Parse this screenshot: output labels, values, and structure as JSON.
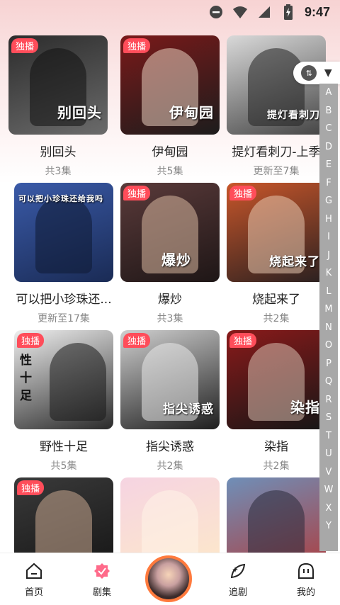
{
  "status_bar": {
    "time": "9:47"
  },
  "sort_control": {
    "icon": "sort-az-icon",
    "chevron": "chevron-down-icon"
  },
  "alphabet": [
    "A",
    "B",
    "C",
    "D",
    "E",
    "F",
    "G",
    "H",
    "I",
    "J",
    "K",
    "L",
    "M",
    "N",
    "O",
    "P",
    "Q",
    "R",
    "S",
    "T",
    "U",
    "V",
    "W",
    "X",
    "Y"
  ],
  "grid": {
    "items": [
      {
        "title": "别回头",
        "sub": "共3集",
        "badge": "独播",
        "cover_text": "别回头",
        "cover_colors": [
          "#2c2c2c",
          "#6b6b6b"
        ]
      },
      {
        "title": "伊甸园",
        "sub": "共5集",
        "badge": "独播",
        "cover_text": "伊甸园",
        "cover_colors": [
          "#7a1a1a",
          "#1c1c1c"
        ]
      },
      {
        "title": "提灯看刺刀-上季",
        "sub": "更新至7集",
        "badge": "",
        "cover_text": "提灯看刺刀",
        "cover_colors": [
          "#d9d9d9",
          "#444444"
        ]
      },
      {
        "title": "可以把小珍珠还...",
        "sub": "更新至17集",
        "badge": "",
        "cover_text": "可以把小珍珠还给我吗",
        "cover_colors": [
          "#3a5aa8",
          "#1a2b55"
        ]
      },
      {
        "title": "爆炒",
        "sub": "共3集",
        "badge": "独播",
        "cover_text": "爆炒",
        "cover_colors": [
          "#5a3a3a",
          "#1e1616"
        ]
      },
      {
        "title": "烧起来了",
        "sub": "共2集",
        "badge": "独播",
        "cover_text": "烧起来了",
        "cover_colors": [
          "#c8562a",
          "#2a2020"
        ]
      },
      {
        "title": "野性十足",
        "sub": "共5集",
        "badge": "独播",
        "cover_text": "性十足",
        "cover_colors": [
          "#efefef",
          "#2a2a2a"
        ]
      },
      {
        "title": "指尖诱惑",
        "sub": "共2集",
        "badge": "独播",
        "cover_text": "指尖诱惑",
        "cover_colors": [
          "#cfcfcf",
          "#1e1e1e"
        ]
      },
      {
        "title": "染指",
        "sub": "共2集",
        "badge": "独播",
        "cover_text": "染指",
        "cover_colors": [
          "#8a1a1a",
          "#161616"
        ]
      },
      {
        "title": "",
        "sub": "",
        "badge": "独播",
        "cover_text": "",
        "cover_colors": [
          "#3a3a3a",
          "#141414"
        ]
      },
      {
        "title": "",
        "sub": "",
        "badge": "",
        "cover_text": "",
        "cover_colors": [
          "#f6d4e2",
          "#fde9c8"
        ]
      },
      {
        "title": "",
        "sub": "",
        "badge": "",
        "cover_text": "",
        "cover_colors": [
          "#6f8fb8",
          "#b03a3a"
        ]
      }
    ]
  },
  "bottom_nav": {
    "items": [
      {
        "label": "首页",
        "icon": "home-icon"
      },
      {
        "label": "剧集",
        "icon": "episodes-icon"
      },
      {
        "label": "追剧",
        "icon": "follow-icon"
      },
      {
        "label": "我的",
        "icon": "profile-icon"
      }
    ]
  },
  "colors": {
    "badge": "#ff4d5a",
    "accent_orange": "#ff7a3d",
    "active_pink": "#ff6a8a"
  }
}
